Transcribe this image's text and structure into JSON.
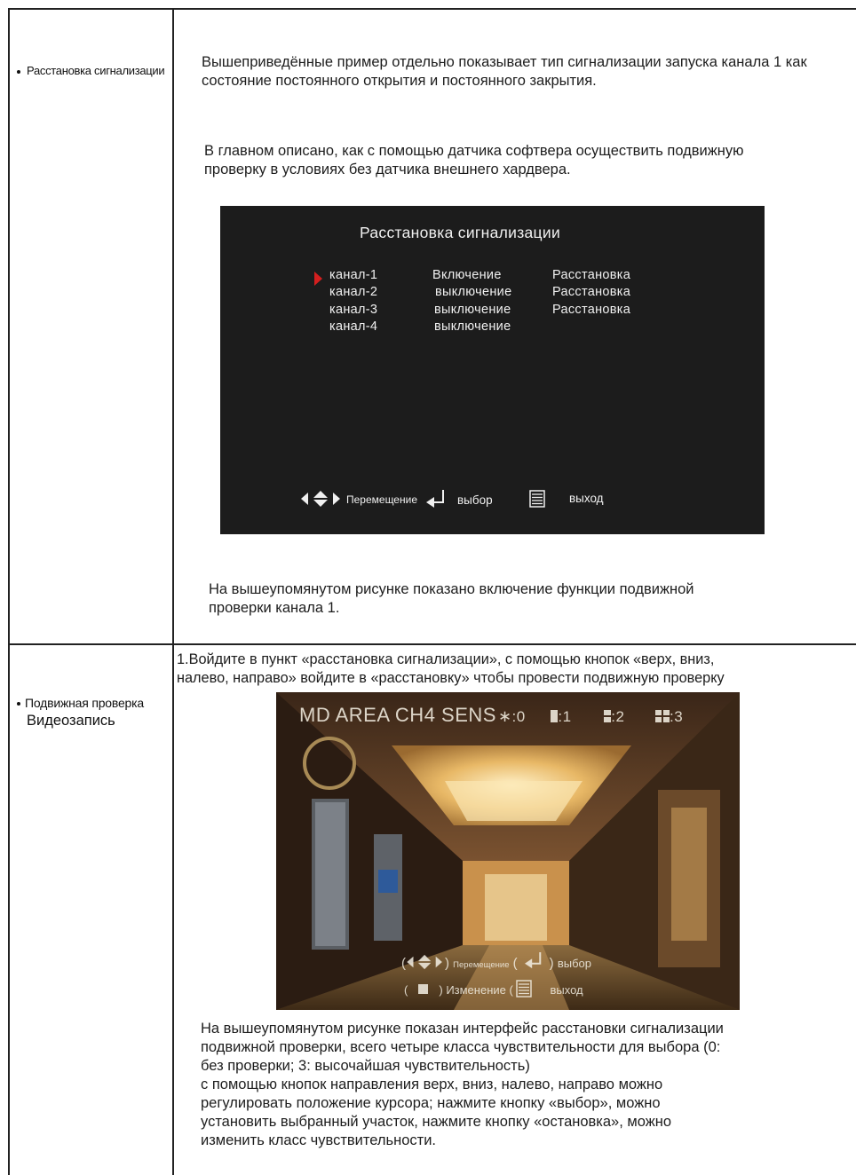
{
  "rows": [
    {
      "label": "Расстановка сигнализации",
      "para_top": "Вышеприведённые пример отдельно показывает тип сигнализации запуска канала 1 как состояние постоянного открытия и постоянного закрытия.",
      "para_mid": "В главном описано, как с помощью датчика софтвера осуществить подвижную проверку в условиях без датчика внешнего хардвера.",
      "para_bottom": "На вышеупомянутом рисунке показано включение функции подвижной проверки канала 1."
    },
    {
      "label_line1": "Подвижная проверка",
      "label_line2": "Видеозапись",
      "intro_line1": "1.Войдите в пункт «расстановка сигнализации», с помощью кнопок «верх, вниз,",
      "intro_line2": "налево, направо» войдите в «расстановку» чтобы провести подвижную проверку",
      "desc_lines": [
        "На вышеупомянутом рисунке показан интерфейс расстановки сигнализации",
        "подвижной проверки, всего четыре класса чувствительности для выбора (0:",
        "без проверки; 3: высочайшая чувствительность)",
        "с помощью кнопок направления верх, вниз, налево, направо можно",
        "регулировать положение курсора; нажмите кнопку «выбор», можно",
        "установить выбранный участок, нажмите кнопку «остановка», можно",
        "изменить класс чувствительности."
      ]
    }
  ],
  "osd": {
    "title": "Расстановка сигнализации",
    "channels": [
      {
        "name": "канал-1",
        "state": "Включение",
        "action": "Расстановка",
        "selected": true
      },
      {
        "name": "канал-2",
        "state": "выключение",
        "action": "Расстановка",
        "selected": false
      },
      {
        "name": "канал-3",
        "state": "выключение",
        "action": "Расстановка",
        "selected": false
      },
      {
        "name": "канал-4",
        "state": "выключение",
        "action": "",
        "selected": false
      }
    ],
    "footer": {
      "move_label": "Перемещение",
      "select_label": "выбор",
      "exit_label": "выход",
      "move_icon": "arrows-icon",
      "select_icon": "enter-icon",
      "exit_icon": "menu-icon"
    },
    "accent": "#d41f1f"
  },
  "md_screen": {
    "header": "MD AREA CH4 SENS",
    "sens_levels": [
      {
        "mark": "*",
        "value": "0"
      },
      {
        "mark": "block-1",
        "value": "1"
      },
      {
        "mark": "block-2",
        "value": "2"
      },
      {
        "mark": "block-3",
        "value": "3"
      }
    ],
    "hint_move": "Перемещение",
    "hint_select": "выбор",
    "hint_change": "Изменение",
    "hint_exit": "выход"
  }
}
